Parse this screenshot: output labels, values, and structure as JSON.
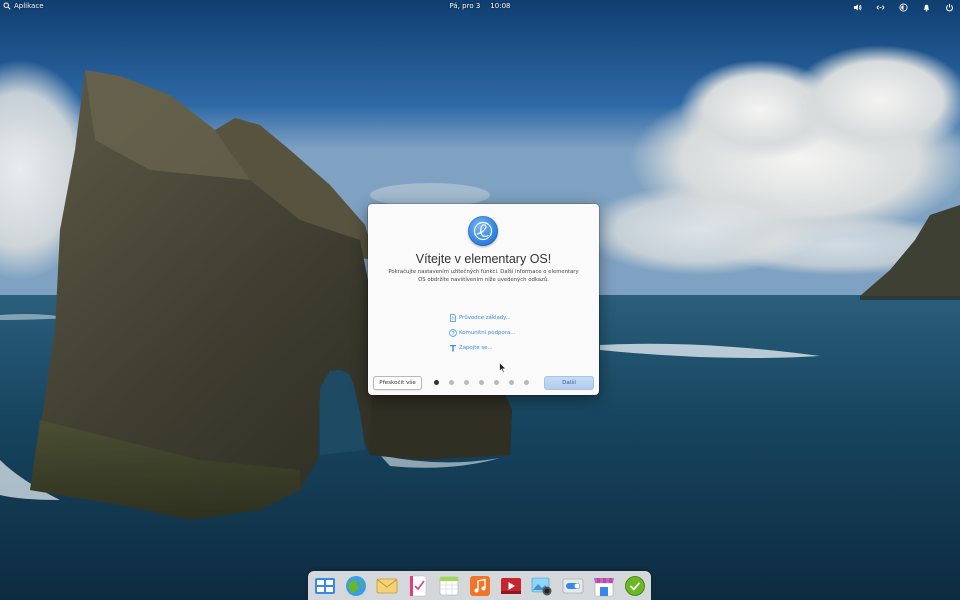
{
  "top_panel": {
    "apps_label": "Aplikace",
    "date": "Pá, pro 3",
    "time": "10:08",
    "indicators": [
      "volume-icon",
      "network-icon",
      "night-light-icon",
      "notifications-icon",
      "power-icon"
    ]
  },
  "dialog": {
    "title": "Vítejte v elementary OS!",
    "description": "Pokračujte nastavením užitečných funkcí. Další informace o elementary OS obdržíte navštívením níže uvedených odkazů.",
    "links": [
      {
        "label": "Průvodce základy...",
        "icon": "document-icon"
      },
      {
        "label": "Komunitní podpora...",
        "icon": "help-icon"
      },
      {
        "label": "Zapojte se...",
        "icon": "tools-icon"
      }
    ],
    "skip_label": "Přeskočit vše",
    "next_label": "Další",
    "page_count": 7,
    "current_page": 1
  },
  "dock": {
    "items": [
      "multitasking-view-icon",
      "web-browser-icon",
      "mail-icon",
      "tasks-icon",
      "calendar-icon",
      "music-icon",
      "videos-icon",
      "photos-icon",
      "settings-icon",
      "appcenter-icon",
      "installer-icon"
    ]
  },
  "colors": {
    "accent": "#3689e6",
    "dialog_bg": "#fafafa",
    "dock_bg": "#ebebeb"
  }
}
